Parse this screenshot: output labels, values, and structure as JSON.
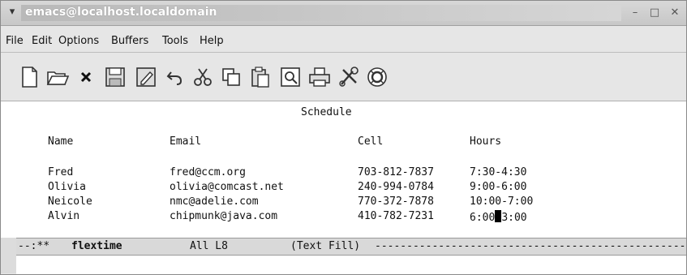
{
  "window": {
    "title": "emacs@localhost.localdomain",
    "menu_icon": "chevron-down-icon",
    "min_label": "–",
    "max_label": "□",
    "close_label": "✕"
  },
  "menubar": {
    "items": [
      "File",
      "Edit",
      "Options",
      "Buffers",
      "Tools",
      "Help"
    ]
  },
  "toolbar": {
    "icons": [
      "new-file-icon",
      "open-folder-icon",
      "close-icon",
      "save-icon",
      "save-as-icon",
      "undo-icon",
      "cut-icon",
      "copy-icon",
      "paste-icon",
      "search-icon",
      "print-icon",
      "preferences-icon",
      "help-icon"
    ]
  },
  "buffer": {
    "heading": "Schedule",
    "headers": [
      "Name",
      "Email",
      "Cell",
      "Hours"
    ],
    "rows": [
      {
        "name": "Fred",
        "email": "fred@ccm.org",
        "cell": "703-812-7837",
        "hours": "7:30-4:30"
      },
      {
        "name": "Olivia",
        "email": "olivia@comcast.net",
        "cell": "240-994-0784",
        "hours": "9:00-6:00"
      },
      {
        "name": "Neicole",
        "email": "nmc@adelie.com",
        "cell": "770-372-7878",
        "hours": "10:00-7:00"
      },
      {
        "name": "Alvin",
        "email": "chipmunk@java.com",
        "cell": "410-782-7231",
        "hours_before_cursor": "6:00",
        "hours_after_cursor": "3:00"
      }
    ]
  },
  "modeline": {
    "prefix": "--:**",
    "buffer_name": "flextime",
    "position": "All L8",
    "mode": "(Text Fill)",
    "fill": "------------------------------------------------------------"
  }
}
